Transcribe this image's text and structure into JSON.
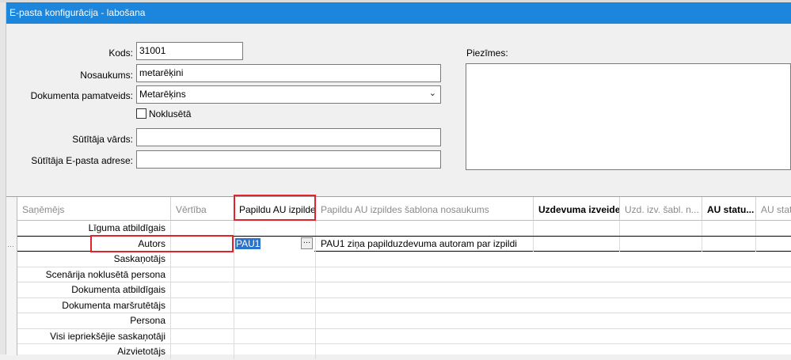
{
  "window": {
    "title": "E-pasta konfigurācija - labošana"
  },
  "form": {
    "kods": {
      "label": "Kods:",
      "value": "31001"
    },
    "nosaukums": {
      "label": "Nosaukums:",
      "value": "metarēķini"
    },
    "dokumenta_pamatveids": {
      "label": "Dokumenta pamatveids:",
      "value": "Metarēķins"
    },
    "noklusets": {
      "label": "Noklusētā",
      "checked": false
    },
    "sutitaja_vards": {
      "label": "Sūtītāja vārds:",
      "value": ""
    },
    "sutitaja_epasts": {
      "label": "Sūtītāja E-pasta adrese:",
      "value": ""
    },
    "piezimes": {
      "label": "Piezīmes:",
      "value": ""
    }
  },
  "grid": {
    "columns": [
      "Saņēmējs",
      "Vērtība",
      "Papildu AU izpilde",
      "Papildu AU izpildes šablona nosaukums",
      "Uzdevuma izveide",
      "Uzd. izv. šabl. n...",
      "AU statu...",
      "AU statu"
    ],
    "rows": [
      {
        "sanemejs": "Līguma atbildīgais",
        "vertiba": "",
        "papildu": "",
        "sablons": ""
      },
      {
        "sanemejs": "Autors",
        "vertiba": "",
        "papildu": "PAU1",
        "sablons": "PAU1 ziņa papilduzdevuma autoram par izpildi"
      },
      {
        "sanemejs": "Saskaņotājs",
        "vertiba": "",
        "papildu": "",
        "sablons": ""
      },
      {
        "sanemejs": "Scenārija noklusētā persona",
        "vertiba": "",
        "papildu": "",
        "sablons": ""
      },
      {
        "sanemejs": "Dokumenta atbildīgais",
        "vertiba": "",
        "papildu": "",
        "sablons": ""
      },
      {
        "sanemejs": "Dokumenta maršrutētājs",
        "vertiba": "",
        "papildu": "",
        "sablons": ""
      },
      {
        "sanemejs": "Persona",
        "vertiba": "",
        "papildu": "",
        "sablons": ""
      },
      {
        "sanemejs": "Visi iepriekšējie saskaņotāji",
        "vertiba": "",
        "papildu": "",
        "sablons": ""
      },
      {
        "sanemejs": "Aizvietotājs",
        "vertiba": "",
        "papildu": "",
        "sablons": ""
      }
    ]
  },
  "colors": {
    "titlebar": "#1c86dc",
    "highlight": "#e0232c",
    "selection": "#2b74c9"
  }
}
